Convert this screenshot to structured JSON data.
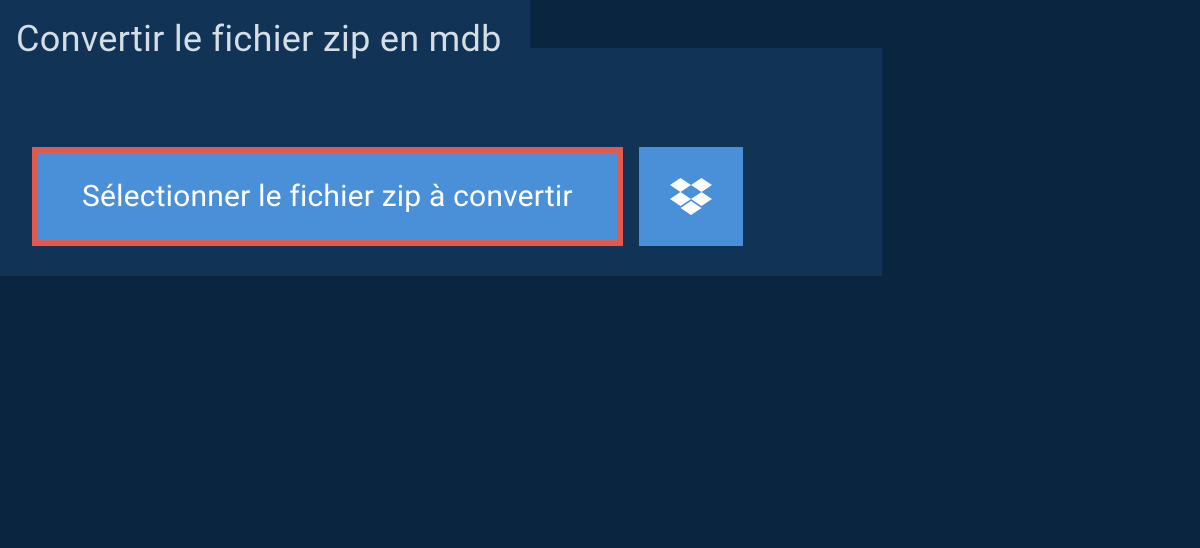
{
  "header": {
    "title": "Convertir le fichier zip en mdb"
  },
  "actions": {
    "select_file_label": "Sélectionner le fichier zip à convertir"
  },
  "colors": {
    "background": "#0a2540",
    "panel": "#113456",
    "button": "#4a90d9",
    "highlight_border": "#e05a50",
    "text_light": "#d5dde5",
    "text_white": "#ffffff"
  }
}
